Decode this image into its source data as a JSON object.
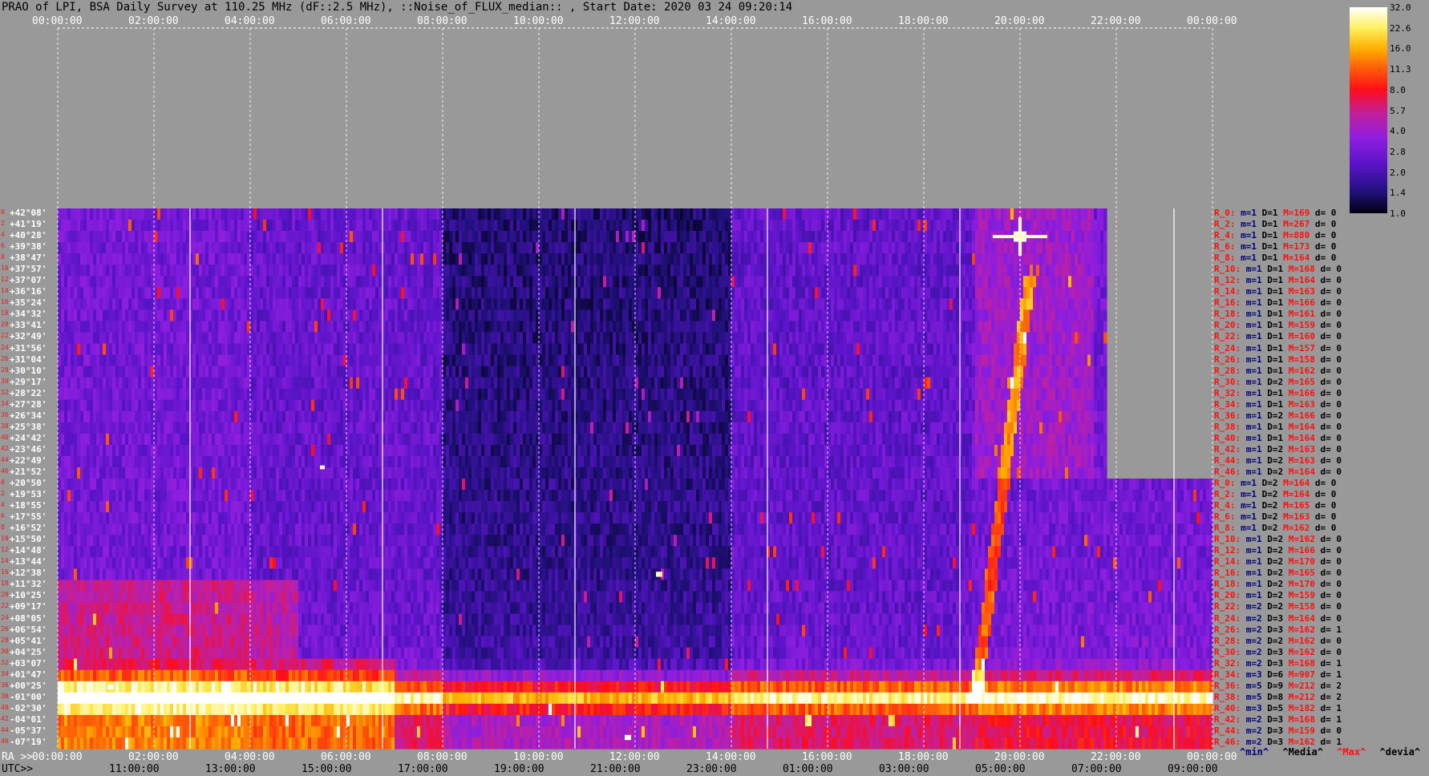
{
  "title": "PRAO of LPI, BSA Daily Survey at 110.25 MHz (dF::2.5 MHz), ::Noise_of_FLUX_median:: , Start Date: 2020 03 24 09:20:14",
  "chart_data": {
    "type": "heatmap",
    "top_axis_ticks": [
      "00:00:00",
      "02:00:00",
      "04:00:00",
      "06:00:00",
      "08:00:00",
      "10:00:00",
      "12:00:00",
      "14:00:00",
      "16:00:00",
      "18:00:00",
      "20:00:00",
      "22:00:00",
      "00:00:00"
    ],
    "ra_axis_label": "RA >>",
    "ra_axis_ticks": [
      "00:00:00",
      "02:00:00",
      "04:00:00",
      "06:00:00",
      "08:00:00",
      "10:00:00",
      "12:00:00",
      "14:00:00",
      "16:00:00",
      "18:00:00",
      "20:00:00",
      "22:00:00",
      "00:00:00"
    ],
    "utc_axis_label": "UTC>>",
    "utc_axis_ticks": [
      "11:00:00",
      "13:00:00",
      "15:00:00",
      "17:00:00",
      "19:00:00",
      "21:00:00",
      "23:00:00",
      "01:00:00",
      "03:00:00",
      "05:00:00",
      "07:00:00",
      "09:00:00"
    ],
    "declinations": [
      "+42°08'",
      "+41°19'",
      "+40°28'",
      "+39°38'",
      "+38°47'",
      "+37°57'",
      "+37°07'",
      "+36°16'",
      "+35°24'",
      "+34°32'",
      "+33°41'",
      "+32°49'",
      "+31°56'",
      "+31°04'",
      "+30°10'",
      "+29°17'",
      "+28°22'",
      "+27°28'",
      "+26°34'",
      "+25°38'",
      "+24°42'",
      "+23°46'",
      "+22°49'",
      "+21°52'",
      "+20°50'",
      "+19°53'",
      "+18°55'",
      "+17°55'",
      "+16°52'",
      "+15°50'",
      "+14°48'",
      "+13°44'",
      "+12°38'",
      "+11°32'",
      "+10°25'",
      "+09°17'",
      "+08°05'",
      "+06°54'",
      "+05°41'",
      "+04°25'",
      "+03°07'",
      "+01°47'",
      "+00°25'",
      "-01°00'",
      "-02°30'",
      "-04°01'",
      "-05°37'",
      "-07°19'"
    ],
    "row_index_labels": [
      "0",
      "2",
      "4",
      "6",
      "8",
      "10",
      "12",
      "14",
      "16",
      "18",
      "20",
      "22",
      "24",
      "26",
      "28",
      "30",
      "32",
      "34",
      "36",
      "38",
      "40",
      "42",
      "44",
      "46",
      "0",
      "2",
      "4",
      "6",
      "8",
      "10",
      "12",
      "14",
      "16",
      "18",
      "20",
      "22",
      "24",
      "26",
      "28",
      "30",
      "32",
      "34",
      "36",
      "38",
      "40",
      "42",
      "44",
      "46"
    ],
    "colorbar_labels": [
      "32.0",
      "22.6",
      "16.0",
      "11.3",
      "8.0",
      "5.7",
      "4.0",
      "2.8",
      "2.0",
      "1.4",
      "1.0"
    ],
    "row_stats": [
      {
        "id": "R_0:",
        "m": "m=1",
        "D": "D=1",
        "M": "M=169",
        "d": "d= 0"
      },
      {
        "id": "R_2:",
        "m": "m=1",
        "D": "D=1",
        "M": "M=267",
        "d": "d= 0"
      },
      {
        "id": "R_4:",
        "m": "m=1",
        "D": "D=1",
        "M": "M=880",
        "d": "d= 0"
      },
      {
        "id": "R_6:",
        "m": "m=1",
        "D": "D=1",
        "M": "M=173",
        "d": "d= 0"
      },
      {
        "id": "R_8:",
        "m": "m=1",
        "D": "D=1",
        "M": "M=164",
        "d": "d= 0"
      },
      {
        "id": "R_10:",
        "m": "m=1",
        "D": "D=1",
        "M": "M=168",
        "d": "d= 0"
      },
      {
        "id": "R_12:",
        "m": "m=1",
        "D": "D=1",
        "M": "M=164",
        "d": "d= 0"
      },
      {
        "id": "R_14:",
        "m": "m=1",
        "D": "D=1",
        "M": "M=163",
        "d": "d= 0"
      },
      {
        "id": "R_16:",
        "m": "m=1",
        "D": "D=1",
        "M": "M=166",
        "d": "d= 0"
      },
      {
        "id": "R_18:",
        "m": "m=1",
        "D": "D=1",
        "M": "M=161",
        "d": "d= 0"
      },
      {
        "id": "R_20:",
        "m": "m=1",
        "D": "D=1",
        "M": "M=159",
        "d": "d= 0"
      },
      {
        "id": "R_22:",
        "m": "m=1",
        "D": "D=1",
        "M": "M=160",
        "d": "d= 0"
      },
      {
        "id": "R_24:",
        "m": "m=1",
        "D": "D=1",
        "M": "M=157",
        "d": "d= 0"
      },
      {
        "id": "R_26:",
        "m": "m=1",
        "D": "D=1",
        "M": "M=158",
        "d": "d= 0"
      },
      {
        "id": "R_28:",
        "m": "m=1",
        "D": "D=1",
        "M": "M=162",
        "d": "d= 0"
      },
      {
        "id": "R_30:",
        "m": "m=1",
        "D": "D=2",
        "M": "M=165",
        "d": "d= 0"
      },
      {
        "id": "R_32:",
        "m": "m=1",
        "D": "D=1",
        "M": "M=166",
        "d": "d= 0"
      },
      {
        "id": "R_34:",
        "m": "m=1",
        "D": "D=1",
        "M": "M=163",
        "d": "d= 0"
      },
      {
        "id": "R_36:",
        "m": "m=1",
        "D": "D=2",
        "M": "M=166",
        "d": "d= 0"
      },
      {
        "id": "R_38:",
        "m": "m=1",
        "D": "D=1",
        "M": "M=164",
        "d": "d= 0"
      },
      {
        "id": "R_40:",
        "m": "m=1",
        "D": "D=1",
        "M": "M=164",
        "d": "d= 0"
      },
      {
        "id": "R_42:",
        "m": "m=1",
        "D": "D=2",
        "M": "M=163",
        "d": "d= 0"
      },
      {
        "id": "R_44:",
        "m": "m=1",
        "D": "D=2",
        "M": "M=163",
        "d": "d= 0"
      },
      {
        "id": "R_46:",
        "m": "m=1",
        "D": "D=2",
        "M": "M=164",
        "d": "d= 0"
      },
      {
        "id": "R_0:",
        "m": "m=1",
        "D": "D=2",
        "M": "M=164",
        "d": "d= 0"
      },
      {
        "id": "R_2:",
        "m": "m=1",
        "D": "D=2",
        "M": "M=164",
        "d": "d= 0"
      },
      {
        "id": "R_4:",
        "m": "m=1",
        "D": "D=2",
        "M": "M=165",
        "d": "d= 0"
      },
      {
        "id": "R_6:",
        "m": "m=1",
        "D": "D=2",
        "M": "M=163",
        "d": "d= 0"
      },
      {
        "id": "R_8:",
        "m": "m=1",
        "D": "D=2",
        "M": "M=162",
        "d": "d= 0"
      },
      {
        "id": "R_10:",
        "m": "m=1",
        "D": "D=2",
        "M": "M=162",
        "d": "d= 0"
      },
      {
        "id": "R_12:",
        "m": "m=1",
        "D": "D=2",
        "M": "M=166",
        "d": "d= 0"
      },
      {
        "id": "R_14:",
        "m": "m=1",
        "D": "D=2",
        "M": "M=170",
        "d": "d= 0"
      },
      {
        "id": "R_16:",
        "m": "m=1",
        "D": "D=2",
        "M": "M=165",
        "d": "d= 0"
      },
      {
        "id": "R_18:",
        "m": "m=1",
        "D": "D=2",
        "M": "M=170",
        "d": "d= 0"
      },
      {
        "id": "R_20:",
        "m": "m=1",
        "D": "D=2",
        "M": "M=159",
        "d": "d= 0"
      },
      {
        "id": "R_22:",
        "m": "m=2",
        "D": "D=2",
        "M": "M=158",
        "d": "d= 0"
      },
      {
        "id": "R_24:",
        "m": "m=2",
        "D": "D=3",
        "M": "M=164",
        "d": "d= 0"
      },
      {
        "id": "R_26:",
        "m": "m=2",
        "D": "D=3",
        "M": "M=162",
        "d": "d= 1"
      },
      {
        "id": "R_28:",
        "m": "m=2",
        "D": "D=2",
        "M": "M=162",
        "d": "d= 0"
      },
      {
        "id": "R_30:",
        "m": "m=2",
        "D": "D=3",
        "M": "M=162",
        "d": "d= 0"
      },
      {
        "id": "R_32:",
        "m": "m=2",
        "D": "D=3",
        "M": "M=168",
        "d": "d= 1"
      },
      {
        "id": "R_34:",
        "m": "m=3",
        "D": "D=6",
        "M": "M=907",
        "d": "d= 1"
      },
      {
        "id": "R_36:",
        "m": "m=5",
        "D": "D=9",
        "M": "M=212",
        "d": "d= 2"
      },
      {
        "id": "R_38:",
        "m": "m=5",
        "D": "D=8",
        "M": "M=212",
        "d": "d= 2"
      },
      {
        "id": "R_40:",
        "m": "m=3",
        "D": "D=5",
        "M": "M=182",
        "d": "d= 1"
      },
      {
        "id": "R_42:",
        "m": "m=2",
        "D": "D=3",
        "M": "M=168",
        "d": "d= 1"
      },
      {
        "id": "R_44:",
        "m": "m=2",
        "D": "D=3",
        "M": "M=159",
        "d": "d= 0"
      },
      {
        "id": "R_46:",
        "m": "m=2",
        "D": "D=3",
        "M": "M=162",
        "d": "d= 1"
      }
    ],
    "legend": {
      "min": "^min^",
      "media": "^Media^",
      "max": "^Max^",
      "devia": "^devia^"
    },
    "colors": {
      "min": "#00007a",
      "media": "#000000",
      "max": "#ff1010",
      "devia": "#000000"
    }
  }
}
